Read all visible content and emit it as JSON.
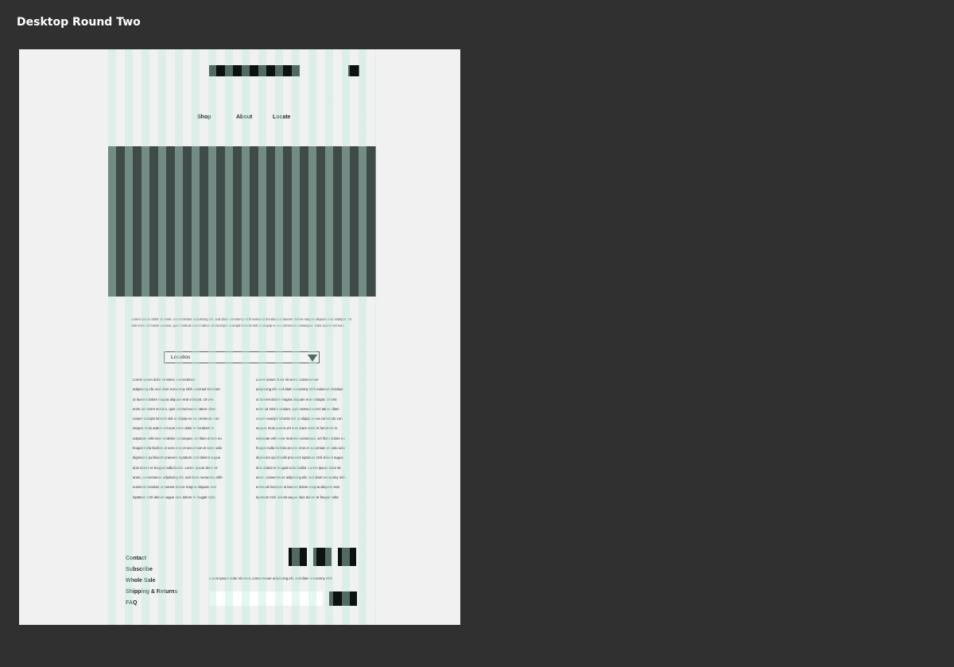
{
  "canvas": {
    "title": "Desktop Round Two"
  },
  "header": {
    "logo": "logo-placeholder",
    "cart": "cart-placeholder"
  },
  "nav": {
    "shop": "Shop",
    "about": "About",
    "locate": "Locate"
  },
  "intro": {
    "text": "Lorem ipsum dolor sit amet, consectetuer adipiscing elit, sed diam nonummy nibh euismod tincidunt ut laoreet dolore magna aliquam erat volutpat. Ut wisi enim ad minim veniam, quis nostrud exerci tation ullamcorper suscipit lobortis nisl ut aliquip ex ea commodo consequat. Duis autem vel eum"
  },
  "location_select": {
    "label": "Locatios"
  },
  "columns": {
    "left": [
      "Lorem ipsum dolor sit amet, consectetuer",
      "adipiscing elit, sed diam nonummy nibh euismod tincidunt",
      "ut laoreet dolore magna aliquam erat volutpat. Ut wisi",
      "enim ad minim veniam, quis nostrud exerci tation ullam",
      "corper suscipit lobortis nisl ut aliquip ex ea commodo con",
      "sequat. Duis autem vel eum iriure dolor in hendrerit in",
      "vulputate velit esse molestie consequat, vel illum dolore eu",
      "feugiat nulla facilisis at vero eros et accumsan et iusto odio",
      "dignissim qui blandit praesent luptatum zzril delenit augue",
      "duis dolore te feugait nulla facilisi. Lorem ipsum dolor sit",
      "amet, consectetuer adipiscing elit, sed diam nonummy nibh",
      "euismod tincidunt ut laoreet dolore magna aliquam erat",
      "luptatum zzril delenit augue duis dolore te feugait nulla"
    ],
    "right": [
      "Lorem ipsum dolor sit amet, consectetuer",
      "adipiscing elit, sed diam nonummy nibh euismod tincidunt",
      "ut laoreet dolore magna aliquam erat volutpat. Ut wisi",
      "enim ad minim veniam, quis nostrud exerci tation ullam",
      "corper suscipit lobortis nisl ut aliquip ex ea commodo con",
      "sequat. Duis autem vel eum iriure dolor in hendrerit in",
      "vulputate velit esse molestie consequat, vel illum dolore eu",
      "feugiat nulla facilisis at vero eros et accumsan et iusto odio",
      "dignissim qui blandit praesent luptatum zzril delenit augue",
      "duis dolore te feugait nulla facilisi. Lorem ipsum dolor sit",
      "amet, consectetuer adipiscing elit, sed diam nonummy nibh",
      "euismod tincidunt ut laoreet dolore magna aliquam erat",
      "luptatum zzril delenit augue duis dolore te feugait nulla"
    ]
  },
  "footer": {
    "links": [
      "Contact",
      "Subscribe",
      "Whole Sale",
      "Shipping & Returns",
      "FAQ"
    ],
    "newsletter_text": "Lorem ipsum dolor sit amet, consectetuer adipiscing elit, sed diam nonummy nibh",
    "social": [
      "social-placeholder-1",
      "social-placeholder-2",
      "social-placeholder-3"
    ]
  },
  "colors": {
    "canvas_bg": "#303030",
    "artboard_bg": "#f1f1f1",
    "hero": "#3f4b48",
    "dark_block": "#0b1210",
    "grid_column": "#beebdc"
  }
}
